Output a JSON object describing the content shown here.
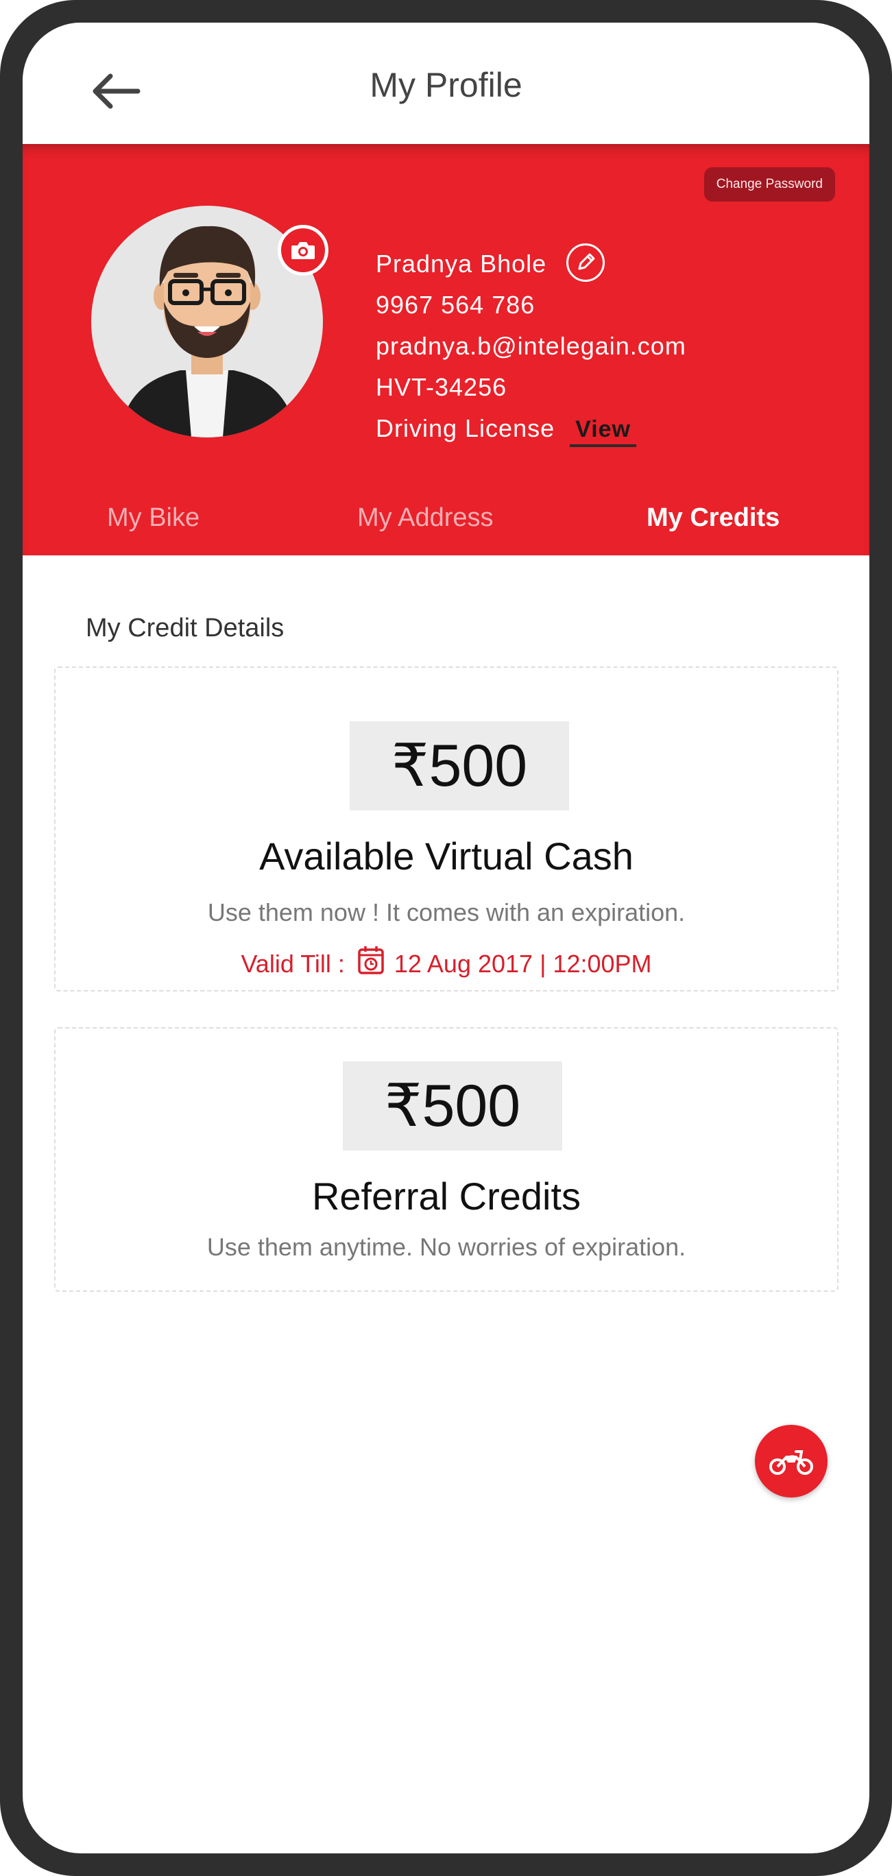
{
  "header": {
    "title": "My Profile"
  },
  "profile": {
    "change_password": "Change Password",
    "name": "Pradnya Bhole",
    "phone": "9967 564 786",
    "email": "pradnya.b@intelegain.com",
    "id": "HVT-34256",
    "license_label": "Driving License",
    "license_view": "View"
  },
  "tabs": [
    {
      "label": "My Bike",
      "active": false
    },
    {
      "label": "My Address",
      "active": false
    },
    {
      "label": "My Credits",
      "active": true
    }
  ],
  "credits": {
    "section_title": "My Credit Details",
    "virtual_cash": {
      "amount": "₹500",
      "title": "Available Virtual Cash",
      "subtitle": "Use them now ! It comes with an expiration.",
      "valid_label": "Valid Till :",
      "valid_date": "12 Aug 2017 | 12:00PM"
    },
    "referral": {
      "amount": "₹500",
      "title": "Referral Credits",
      "subtitle": "Use them anytime. No worries of expiration."
    }
  },
  "colors": {
    "brand_red": "#e8212a",
    "frame": "#2f2f2f"
  },
  "icons": {
    "back": "back-arrow-icon",
    "camera": "camera-icon",
    "edit": "pencil-icon",
    "calendar": "calendar-icon",
    "fab": "motorbike-icon"
  }
}
